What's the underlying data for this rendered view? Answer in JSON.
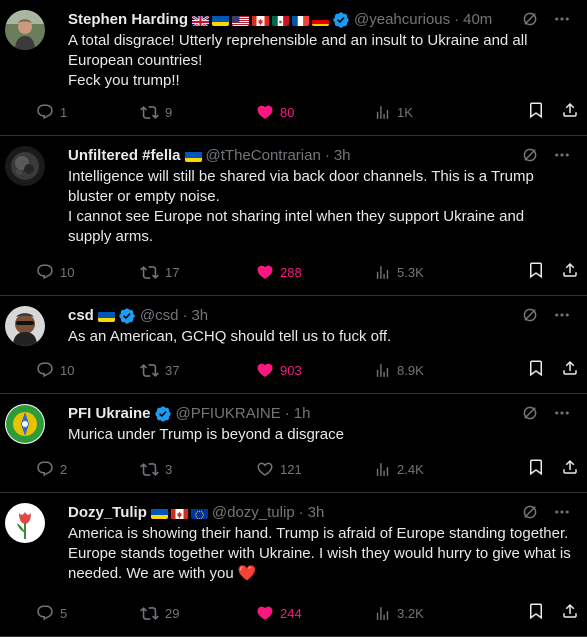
{
  "tweets": [
    {
      "name": "Stephen Harding",
      "flags": [
        "uk",
        "ukraine",
        "us",
        "canada",
        "mexico",
        "france",
        "germany"
      ],
      "verified": true,
      "handle": "@yeahcurious",
      "time": "40m",
      "lines": [
        "A total disgrace! Utterly reprehensible and an insult to Ukraine and all European countries!",
        "Feck you trump!!"
      ],
      "replies": "1",
      "reposts": "9",
      "likes": "80",
      "liked": true,
      "views": "1K",
      "avatar": "photo-man-outdoor"
    },
    {
      "name": "Unfiltered #fella",
      "flags": [
        "ukraine"
      ],
      "verified": false,
      "handle": "@tTheContrarian",
      "time": "3h",
      "lines": [
        "Intelligence will still be shared via back door channels. This is a Trump bluster or empty noise.",
        "I cannot see Europe not sharing intel when they support Ukraine and supply arms."
      ],
      "replies": "10",
      "reposts": "17",
      "likes": "288",
      "liked": true,
      "views": "5.3K",
      "avatar": "dark-texture"
    },
    {
      "name": "csd",
      "flags": [
        "ukraine"
      ],
      "verified": true,
      "handle": "@csd",
      "time": "3h",
      "lines": [
        "As an American, GCHQ should tell us to fuck off."
      ],
      "replies": "10",
      "reposts": "37",
      "likes": "903",
      "liked": true,
      "views": "8.9K",
      "avatar": "photo-man-sunglasses"
    },
    {
      "name": "PFI Ukraine",
      "flags": [],
      "verified": true,
      "handle": "@PFIUKRAINE",
      "time": "1h",
      "lines": [
        "Murica under Trump is beyond a disgrace"
      ],
      "replies": "2",
      "reposts": "3",
      "likes": "121",
      "liked": false,
      "views": "2.4K",
      "avatar": "green-emblem"
    },
    {
      "name": "Dozy_Tulip",
      "flags": [
        "ukraine",
        "canada",
        "eu"
      ],
      "verified": false,
      "handle": "@dozy_tulip",
      "time": "3h",
      "lines": [
        "America is showing their hand. Trump is afraid of Europe standing together. Europe stands together with Ukraine. I wish they would hurry to give what is needed. We are with you ❤️"
      ],
      "replies": "5",
      "reposts": "29",
      "likes": "244",
      "liked": true,
      "views": "3.2K",
      "avatar": "tulip"
    }
  ],
  "colors": {
    "like": "#f91880",
    "verified": "#1d9bf0",
    "muted": "#71767b",
    "text": "#e7e9ea",
    "border": "#2f3336"
  },
  "sep": "·"
}
